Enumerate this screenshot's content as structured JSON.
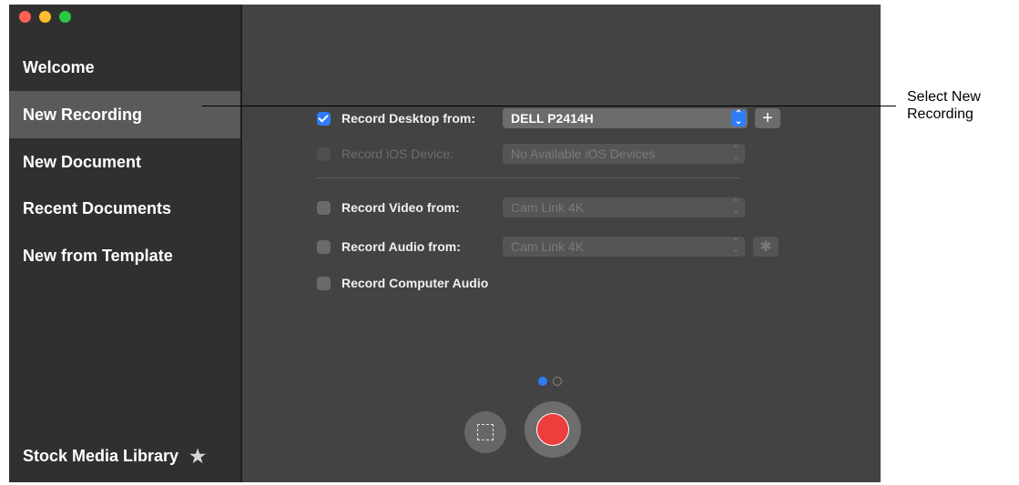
{
  "sidebar": {
    "items": [
      {
        "label": "Welcome"
      },
      {
        "label": "New Recording",
        "selected": true
      },
      {
        "label": "New Document"
      },
      {
        "label": "Recent Documents"
      },
      {
        "label": "New from Template"
      }
    ],
    "stock_media": "Stock Media Library",
    "stock_icon": "star-icon"
  },
  "recording": {
    "desktop": {
      "label": "Record Desktop from:",
      "checked": true,
      "value": "DELL P2414H"
    },
    "ios": {
      "label": "Record iOS Device:",
      "checked": false,
      "disabled": true,
      "value": "No Available iOS Devices"
    },
    "video": {
      "label": "Record Video from:",
      "checked": false,
      "value": "Cam Link 4K"
    },
    "audio": {
      "label": "Record Audio from:",
      "checked": false,
      "value": "Cam Link 4K"
    },
    "computer_audio": {
      "label": "Record Computer Audio",
      "checked": false
    }
  },
  "pager": {
    "current": 1,
    "total": 2
  },
  "callout": {
    "line1": "Select New",
    "line2": "Recording"
  },
  "colors": {
    "accent": "#2e7cf6",
    "record": "#ee3d3d",
    "sidebar": "#303030",
    "content": "#434343"
  }
}
